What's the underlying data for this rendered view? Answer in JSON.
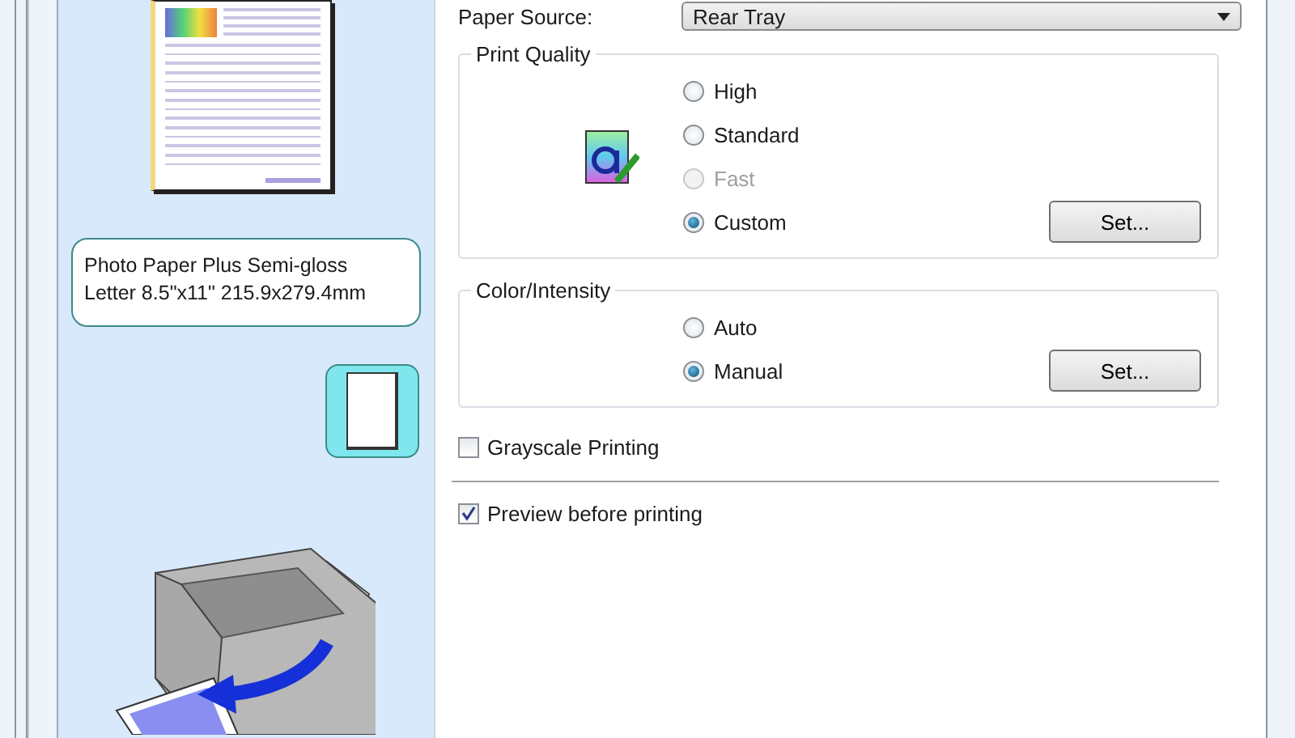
{
  "left_panel": {
    "paper_info": [
      "Photo Paper Plus Semi-gloss",
      "Letter 8.5\"x11\" 215.9x279.4mm"
    ]
  },
  "paper_source": {
    "label": "Paper Source:",
    "value": "Rear Tray"
  },
  "groups": [
    {
      "title": "Print Quality",
      "icon": true,
      "options": [
        {
          "label": "High",
          "selected": false,
          "disabled": false
        },
        {
          "label": "Standard",
          "selected": false,
          "disabled": false
        },
        {
          "label": "Fast",
          "selected": false,
          "disabled": true
        },
        {
          "label": "Custom",
          "selected": true,
          "disabled": false
        }
      ],
      "button": "Set..."
    },
    {
      "title": "Color/Intensity",
      "icon": false,
      "options": [
        {
          "label": "Auto",
          "selected": false,
          "disabled": false
        },
        {
          "label": "Manual",
          "selected": true,
          "disabled": false
        }
      ],
      "button": "Set..."
    }
  ],
  "checkboxes": [
    {
      "label": "Grayscale Printing",
      "checked": false
    },
    {
      "label": "Preview before printing",
      "checked": true
    }
  ]
}
